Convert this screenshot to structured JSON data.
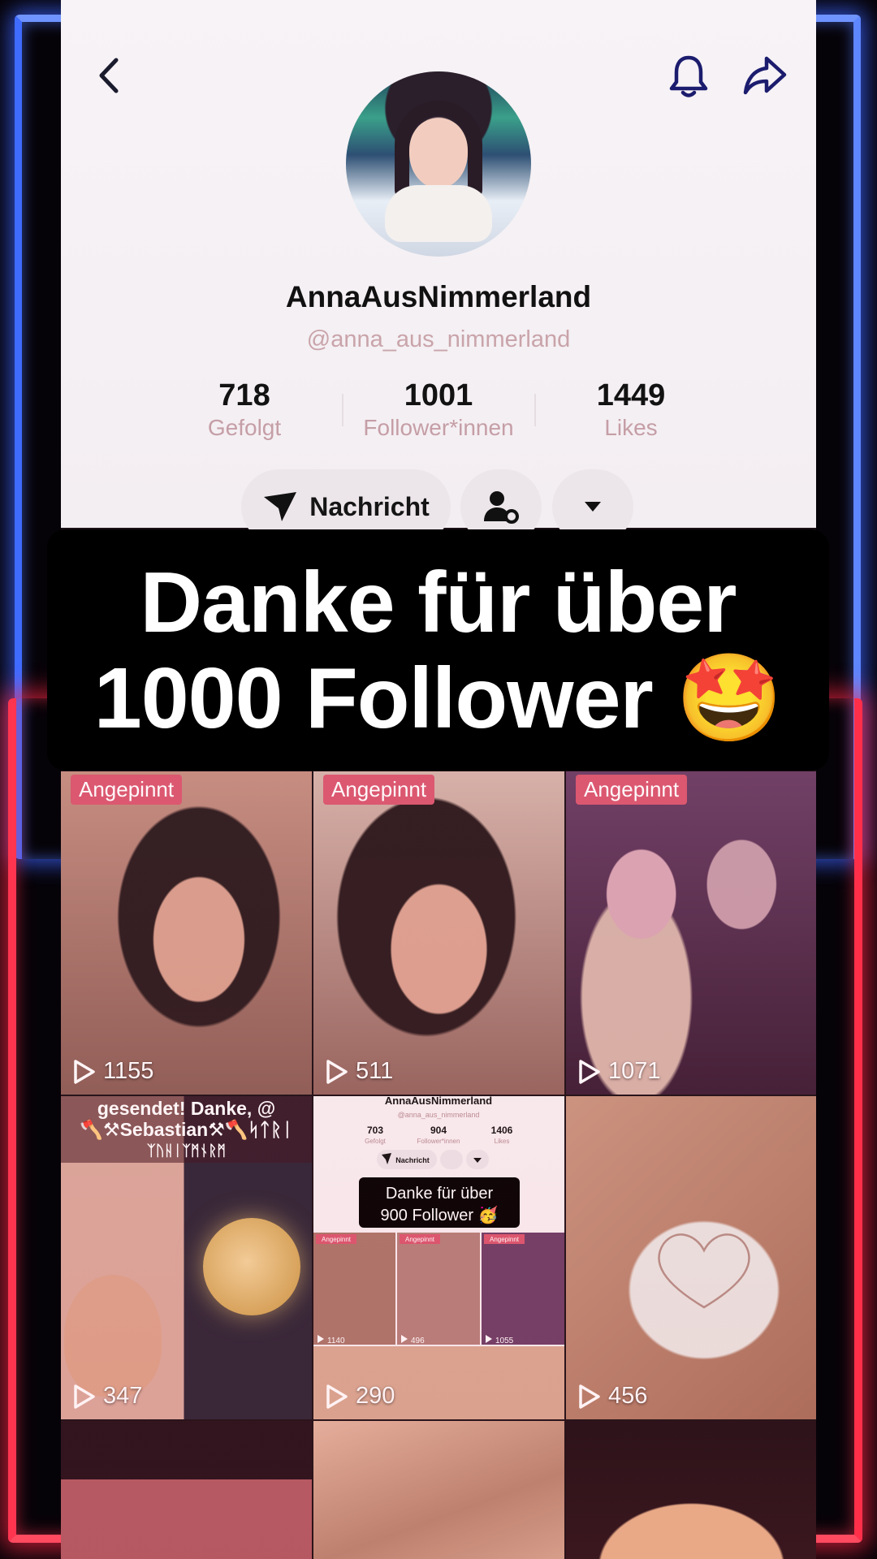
{
  "profile": {
    "display_name": "AnnaAusNimmerland",
    "handle": "@anna_aus_nimmerland",
    "stats": [
      {
        "value": "718",
        "label": "Gefolgt"
      },
      {
        "value": "1001",
        "label": "Follower*innen"
      },
      {
        "value": "1449",
        "label": "Likes"
      }
    ],
    "message_button": "Nachricht",
    "icons": {
      "back": "chevron-left-icon",
      "bell": "bell-icon",
      "share": "share-arrow-icon",
      "friend": "user-gear-icon",
      "more": "caret-down-icon"
    }
  },
  "banner": {
    "line1": "Danke für über",
    "line2": "1000 Follower 🤩"
  },
  "grid": {
    "pinned_label": "Angepinnt",
    "videos": [
      {
        "views": "1155",
        "pinned": true
      },
      {
        "views": "511",
        "pinned": true
      },
      {
        "views": "1071",
        "pinned": true
      },
      {
        "views": "347",
        "pinned": false,
        "caption_lines": [
          "gesendet! Danke, @",
          "🪓⚒Sebastian⚒🪓ᛋᛏᚱᛁ",
          "ᛉᚢᚺᛁᛉᛗᚾᚱᛗ"
        ]
      },
      {
        "views": "290",
        "pinned": false
      },
      {
        "views": "456",
        "pinned": false
      }
    ],
    "nested_screenshot": {
      "display_name": "AnnaAusNimmerland",
      "handle": "@anna_aus_nimmerland",
      "stats": [
        {
          "value": "703",
          "label": "Gefolgt"
        },
        {
          "value": "904",
          "label": "Follower*innen"
        },
        {
          "value": "1406",
          "label": "Likes"
        }
      ],
      "message_button": "Nachricht",
      "banner_line1": "Danke für über",
      "banner_line2": "900 Follower 🥳",
      "pinned_label": "Angepinnt",
      "views": [
        "1140",
        "496",
        "1055"
      ]
    }
  },
  "colors": {
    "neon_blue": "#3f6bff",
    "neon_red": "#ff3550",
    "pinned_badge": "#d9566e",
    "handle_text": "#c9a4aa"
  }
}
